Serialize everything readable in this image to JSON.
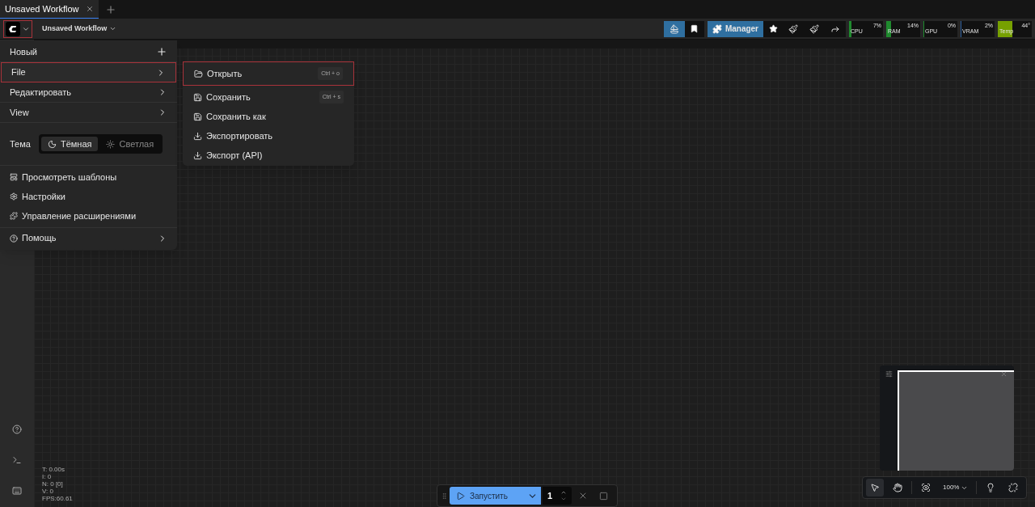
{
  "tabs": [
    {
      "label": "Unsaved Workflow",
      "selected": true
    }
  ],
  "workflow_menu": {
    "label": "Unsaved Workflow"
  },
  "toolbar": {
    "manager_label": "Manager"
  },
  "monitors": [
    {
      "label": "CPU",
      "reading": "7%",
      "level": 0.07,
      "color": "#1f8a2e"
    },
    {
      "label": "RAM",
      "reading": "14%",
      "level": 0.14,
      "color": "#1f8a2e"
    },
    {
      "label": "GPU",
      "reading": "0%",
      "level": 0,
      "color": "#1f8a2e"
    },
    {
      "label": "VRAM",
      "reading": "2%",
      "level": 0.02,
      "color": "#2b5d9c"
    },
    {
      "label": "Temp",
      "reading": "44°",
      "level": 0.44,
      "color": "#76a000"
    }
  ],
  "main_menu": {
    "items": [
      {
        "label": "Новый",
        "kind": "plus",
        "highlighted": false
      },
      {
        "label": "File",
        "kind": "submenu",
        "highlighted": true
      },
      {
        "label": "Редактировать",
        "kind": "submenu",
        "highlighted": false
      },
      {
        "label": "View",
        "kind": "submenu",
        "highlighted": false
      }
    ],
    "theme": {
      "label": "Тема",
      "options": [
        {
          "label": "Тёмная",
          "selected": true
        },
        {
          "label": "Светлая",
          "selected": false
        }
      ]
    },
    "links": [
      {
        "label": "Просмотреть шаблоны",
        "kind": "templates"
      },
      {
        "label": "Настройки",
        "kind": "settings"
      },
      {
        "label": "Управление расширениями",
        "kind": "extensions"
      }
    ],
    "help": {
      "label": "Помощь"
    }
  },
  "file_submenu": [
    {
      "label": "Открыть",
      "kind": "open",
      "shortcut": "Ctrl + o",
      "highlighted": true
    },
    {
      "label": "Сохранить",
      "kind": "save",
      "shortcut": "Ctrl + s",
      "highlighted": false
    },
    {
      "label": "Сохранить как",
      "kind": "save",
      "highlighted": false
    },
    {
      "label": "Экспортировать",
      "kind": "export",
      "highlighted": false
    },
    {
      "label": "Экспорт (API)",
      "kind": "export",
      "highlighted": false
    }
  ],
  "stats": [
    "T: 0.00s",
    "I: 0",
    "N: 0 [0]",
    "V: 0",
    "FPS:60.61"
  ],
  "run_bar": {
    "label": "Запустить",
    "count": "1"
  },
  "canvas_tools": [
    {
      "kind": "select",
      "selected": true
    },
    {
      "kind": "hand",
      "selected": false
    }
  ],
  "zoom": "100%"
}
